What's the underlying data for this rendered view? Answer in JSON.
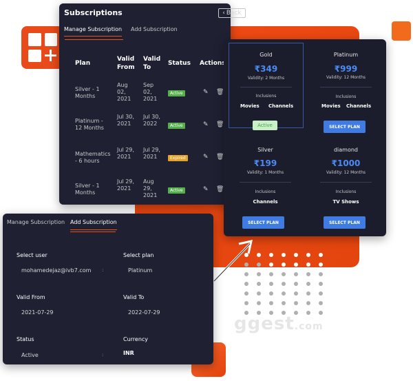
{
  "subscriptions_panel": {
    "title": "Subscriptions",
    "back_label": "Back",
    "back_icon": "chevron-left-icon",
    "tabs": [
      "Manage Subscription",
      "Add Subscription"
    ],
    "columns": [
      "Plan",
      "Valid From",
      "Valid To",
      "Status",
      "Actions"
    ],
    "rows": [
      {
        "plan": "Silver - 1 Months",
        "from": "Aug 02, 2021",
        "to": "Sep 02, 2021",
        "status": "Active"
      },
      {
        "plan": "Platinum - 12 Months",
        "from": "Jul 30, 2021",
        "to": "Jul 30, 2022",
        "status": "Active"
      },
      {
        "plan": "Mathematics - 6 hours",
        "from": "Jul 29, 2021",
        "to": "Jul 29, 2021",
        "status": "Expired"
      },
      {
        "plan": "Silver - 1 Months",
        "from": "Jul 29, 2021",
        "to": "Aug 29, 2021",
        "status": "Active"
      }
    ],
    "colors": {
      "active": "#55b04b",
      "expired": "#e6a32b",
      "accent": "#e8531c"
    }
  },
  "plans_panel": {
    "plans": [
      {
        "name": "Gold",
        "price": "₹349",
        "validity": "Validity: 2 Months",
        "inclusions_label": "Inclusions",
        "features": [
          "Movies",
          "Channels"
        ],
        "button": "Active"
      },
      {
        "name": "Platinum",
        "price": "₹999",
        "validity": "Validity: 12 Months",
        "inclusions_label": "Inclusions",
        "features": [
          "Movies",
          "Channels"
        ],
        "button": "SELECT PLAN"
      },
      {
        "name": "Silver",
        "price": "₹199",
        "validity": "Validity: 1 Months",
        "inclusions_label": "Inclusions",
        "features": [
          "Channels"
        ],
        "button": "SELECT PLAN"
      },
      {
        "name": "diamond",
        "price": "₹1000",
        "validity": "Validity: 12 Months",
        "inclusions_label": "Inclusions",
        "features": [
          "TV Shows"
        ],
        "button": "SELECT PLAN"
      }
    ],
    "colors": {
      "price": "#4c8bf5",
      "button": "#3f7be0"
    }
  },
  "add_panel": {
    "tabs": [
      "Manage Subscription",
      "Add Subscription"
    ],
    "fields": {
      "user_label": "Select user",
      "user_value": "mohamedejaz@ivb7.com",
      "plan_label": "Select plan",
      "plan_value": "Platinum",
      "from_label": "Valid From",
      "from_value": "2021-07-29",
      "to_label": "Valid To",
      "to_value": "2022-07-29",
      "status_label": "Status",
      "status_value": "Active",
      "currency_label": "Currency",
      "currency_value": "INR"
    }
  },
  "watermark": {
    "text": "ggest",
    "suffix": ".com"
  }
}
